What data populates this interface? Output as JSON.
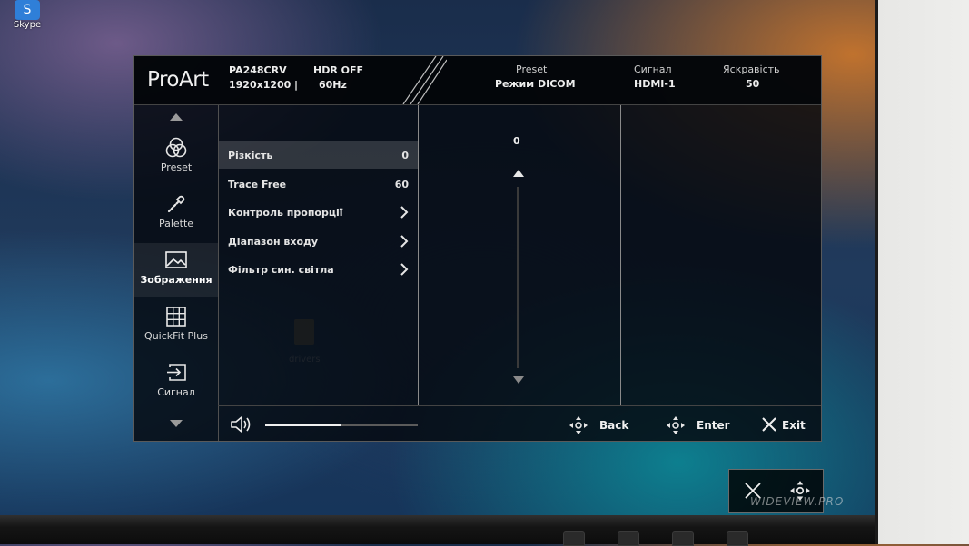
{
  "desktop": {
    "skype_label": "Skype",
    "drivers_label": "drivers",
    "watermark": "WIDEVIEW.PRO"
  },
  "osd": {
    "logo": "ProArt",
    "model": "PA248CRV",
    "resolution": "1920x1200",
    "separator": "|",
    "hdr": "HDR  OFF",
    "refresh": "60Hz",
    "status": [
      {
        "title": "Preset",
        "value": "Режим DICOM"
      },
      {
        "title": "Сигнал",
        "value": "HDMI-1"
      },
      {
        "title": "Яскравість",
        "value": "50"
      }
    ],
    "nav": [
      {
        "label": "Preset",
        "icon": "preset-circles-icon"
      },
      {
        "label": "Palette",
        "icon": "palette-dropper-icon"
      },
      {
        "label": "Зображення",
        "icon": "image-icon",
        "active": true
      },
      {
        "label": "QuickFit Plus",
        "icon": "grid-icon"
      },
      {
        "label": "Сигнал",
        "icon": "input-signal-icon"
      }
    ],
    "menu": [
      {
        "label": "Різкість",
        "value": "0",
        "selected": true
      },
      {
        "label": "Trace Free",
        "value": "60"
      },
      {
        "label": "Контроль пропорції",
        "has_submenu": true
      },
      {
        "label": "Діапазон входу",
        "has_submenu": true
      },
      {
        "label": "Фільтр син. світла",
        "has_submenu": true
      }
    ],
    "adjust_value": "0",
    "volume_level_percent": 50,
    "controls": {
      "back": "Back",
      "enter": "Enter",
      "exit": "Exit"
    }
  },
  "colors": {
    "osd_background": "#05080e",
    "selected_row": "#2a2d33",
    "text": "#e8e8e8"
  }
}
